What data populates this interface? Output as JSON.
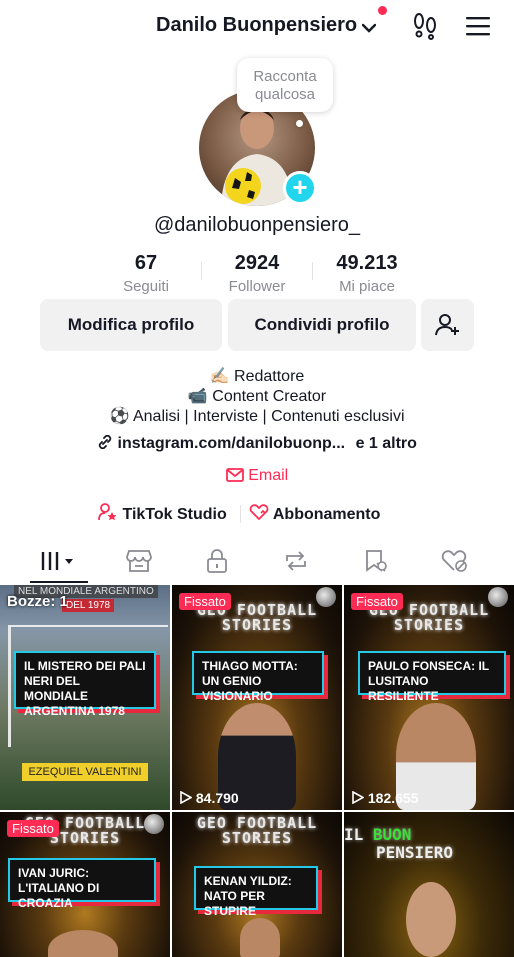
{
  "header": {
    "username": "Danilo Buonpensiero",
    "notification_color": "#fe2c55",
    "icons": [
      "chevron-down-icon",
      "footprints-icon",
      "menu-icon"
    ]
  },
  "profile": {
    "bubble_text": "Racconta qualcosa",
    "handle": "@danilobuonpensiero_"
  },
  "stats": [
    {
      "value": "67",
      "label": "Seguiti"
    },
    {
      "value": "2924",
      "label": "Follower"
    },
    {
      "value": "49.213",
      "label": "Mi piace"
    }
  ],
  "buttons": {
    "edit": "Modifica profilo",
    "share": "Condividi profilo"
  },
  "bio": {
    "line1": "✍🏻 Redattore",
    "line2": "📹 Content Creator",
    "line3": "⚽️ Analisi | Interviste | Contenuti esclusivi",
    "link": "instagram.com/danilobuonp...",
    "link_more": "e 1 altro",
    "email": "Email"
  },
  "tools": {
    "studio": "TikTok Studio",
    "subscription": "Abbonamento"
  },
  "tabs": [
    "videos-tab",
    "shop-tab",
    "private-tab",
    "repost-tab",
    "saved-tab",
    "liked-tab"
  ],
  "colors": {
    "accent": "#fe2c55",
    "cyan": "#20d5ec",
    "button_bg": "#f1f1f2",
    "secondary_text": "#8a8b91"
  },
  "videos": [
    {
      "badge": "Bozze: 1",
      "top_caption": "NEL MONDIALE ARGENTINO",
      "top_caption2": "DEL 1978",
      "title": "IL MISTERO DEI PALI NERI DEL MONDIALE ARGENTINA 1978",
      "tag": "EZEQUIEL VALENTINI"
    },
    {
      "badge": "Fissato",
      "series": "GEO FOOTBALL STORIES",
      "title": "THIAGO MOTTA: UN GENIO VISIONARIO",
      "views": "84.790"
    },
    {
      "badge": "Fissato",
      "series": "GEO FOOTBALL STORIES",
      "title": "PAULO FONSECA: IL LUSITANO RESILIENTE",
      "views": "182.655"
    },
    {
      "badge": "Fissato",
      "series": "GEO FOOTBALL STORIES",
      "title": "IVAN JURIC: L'ITALIANO DI CROAZIA"
    },
    {
      "series": "GEO FOOTBALL STORIES",
      "title": "KENAN YILDIZ: NATO PER STUPIRE"
    },
    {
      "brand_a": "IL",
      "brand_b": "BUON",
      "brand_c": "PENSIERO"
    }
  ]
}
